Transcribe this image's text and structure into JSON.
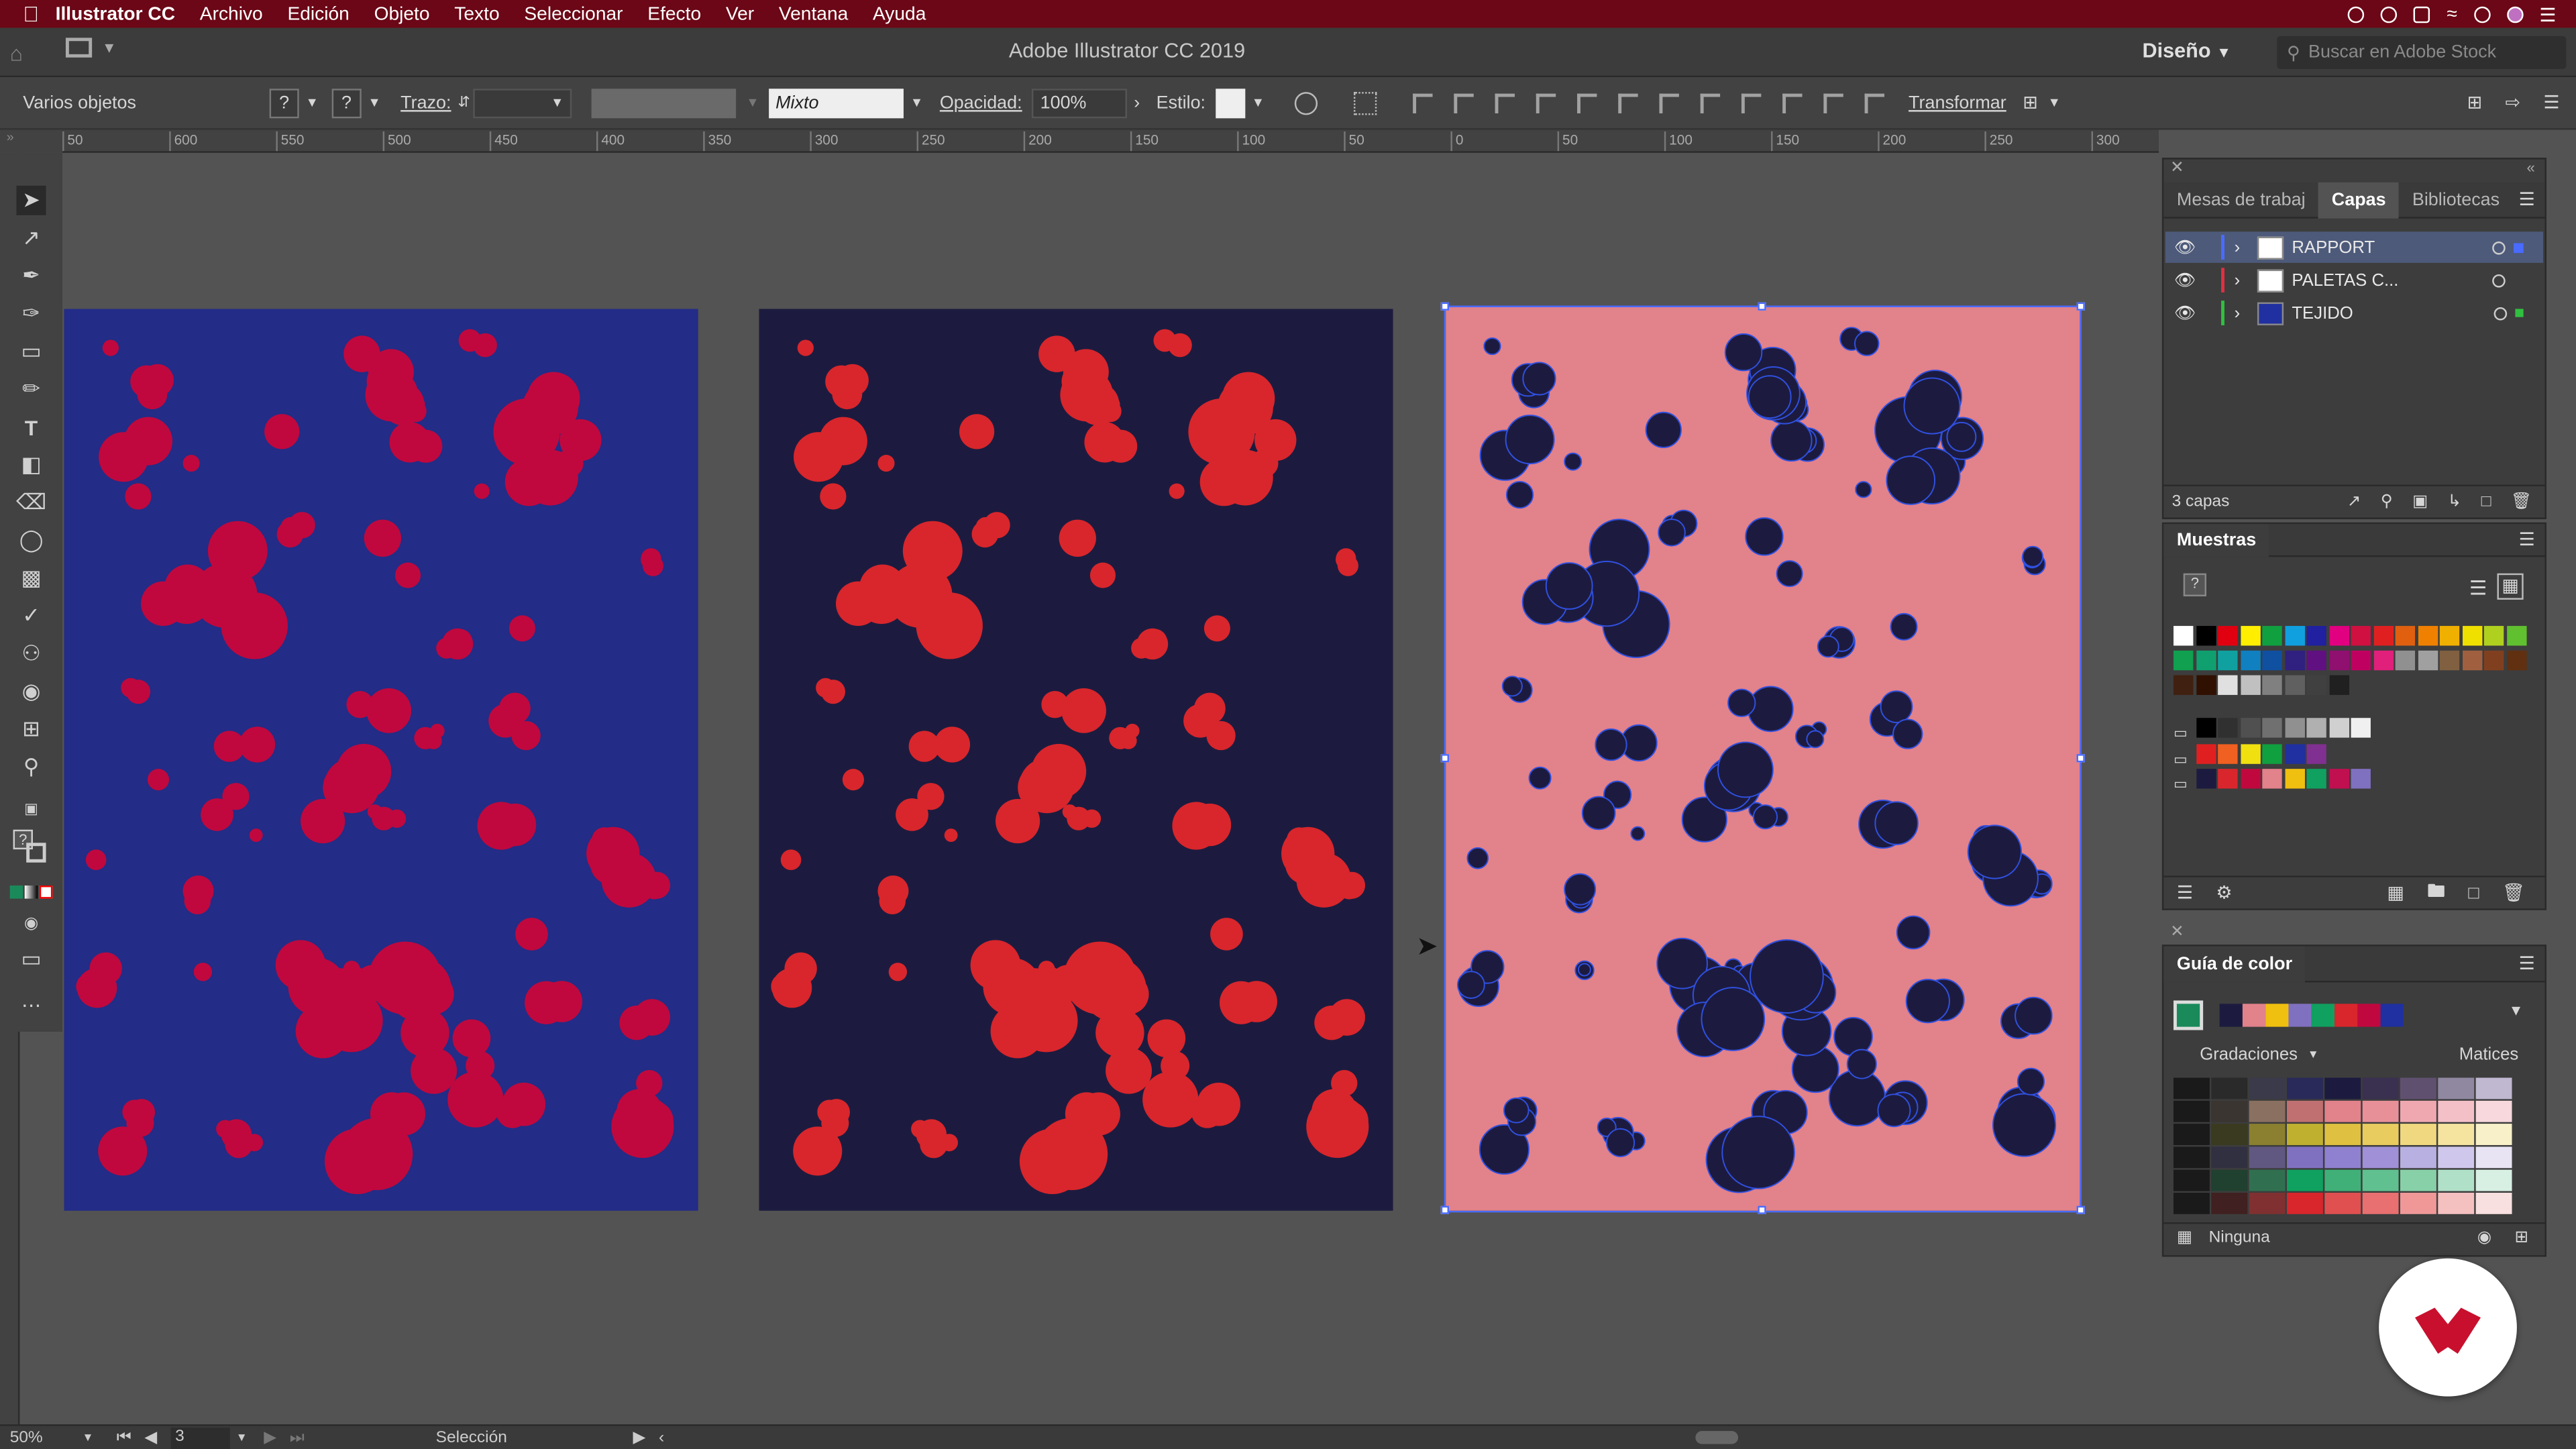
{
  "menubar": {
    "app": "Illustrator CC",
    "items": [
      "Archivo",
      "Edición",
      "Objeto",
      "Texto",
      "Seleccionar",
      "Efecto",
      "Ver",
      "Ventana",
      "Ayuda"
    ]
  },
  "appbar": {
    "title": "Adobe Illustrator CC 2019",
    "workspace": "Diseño",
    "search_placeholder": "Buscar en Adobe Stock"
  },
  "control": {
    "selection": "Varios objetos",
    "stroke_label": "Trazo:",
    "style_mixed": "Mixto",
    "opacity_label": "Opacidad:",
    "opacity_value": "100%",
    "style_label": "Estilo:",
    "transform": "Transformar",
    "q1": "?",
    "q2": "?"
  },
  "ruler": {
    "ticks": [
      "50",
      "600",
      "550",
      "500",
      "450",
      "400",
      "350",
      "300",
      "250",
      "200",
      "150",
      "100",
      "50",
      "0",
      "50",
      "100",
      "150",
      "200",
      "250",
      "300"
    ]
  },
  "artboards": [
    {
      "bg": "#232c86",
      "blob": "#c0083e"
    },
    {
      "bg": "#1c1b3f",
      "blob": "#d8262c"
    },
    {
      "bg": "#e2828a",
      "blob": "#1c1b3f"
    }
  ],
  "layers": {
    "tabs": [
      "Mesas de trabaj",
      "Capas",
      "Bibliotecas"
    ],
    "rows": [
      {
        "name": "RAPPORT",
        "color": "#4a6bff"
      },
      {
        "name": "PALETAS C...",
        "color": "#e03040"
      },
      {
        "name": "TEJIDO",
        "color": "#30c040"
      }
    ],
    "count": "3 capas"
  },
  "swatches": {
    "title": "Muestras",
    "colors": [
      "#ffffff",
      "#000000",
      "#e00010",
      "#ffee00",
      "#10a040",
      "#10a0e0",
      "#2020a0",
      "#e00080",
      "#d01040",
      "#e02020",
      "#e06010",
      "#f08000",
      "#f0b000",
      "#f0e000",
      "#b0d020",
      "#60c030",
      "#10a050",
      "#10a070",
      "#10a0a0",
      "#1080c0",
      "#1050a0",
      "#302080",
      "#601080",
      "#901070",
      "#c00060",
      "#e0207a",
      "#909090",
      "#a0a0a0",
      "#806040",
      "#a06040",
      "#804020",
      "#603010",
      "#402010",
      "#301000",
      "#e0e0e0",
      "#c0c0c0",
      "#808080",
      "#606060",
      "#404040",
      "#202020"
    ],
    "row2": [
      "#000000",
      "#303030",
      "#505050",
      "#707070",
      "#909090",
      "#b0b0b0",
      "#d0d0d0",
      "#f0f0f0"
    ],
    "row3": [
      "#e02020",
      "#f06020",
      "#f0e010",
      "#10a040",
      "#2030a0",
      "#803090"
    ],
    "row4": [
      "#1c1b3f",
      "#d8262c",
      "#c0083e",
      "#e2828a",
      "#f0c010",
      "#10a060",
      "#c01050",
      "#8070c0"
    ]
  },
  "colorguide": {
    "title": "Guía de color",
    "base": "#1a8a5a",
    "harmony": [
      "#1c1b3f",
      "#e2828a",
      "#f0c010",
      "#8070c0",
      "#10a060",
      "#d8262c",
      "#c0083e",
      "#2030a0"
    ],
    "tabs": [
      "Gradaciones",
      "Matices"
    ],
    "none_label": "Ninguna"
  },
  "status": {
    "zoom": "50%",
    "artboard": "3",
    "tool": "Selección"
  }
}
